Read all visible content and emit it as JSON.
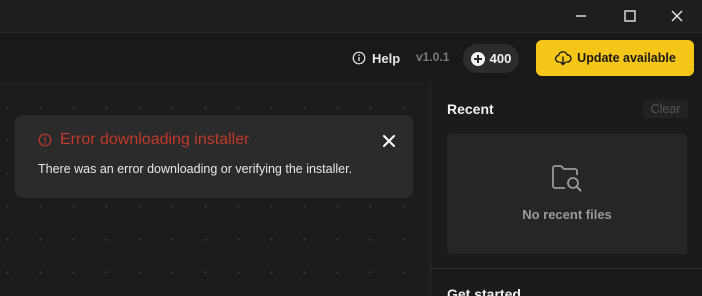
{
  "window_controls": {
    "minimize_icon": "minimize-icon",
    "maximize_icon": "maximize-icon",
    "close_icon": "close-icon"
  },
  "header": {
    "help_label": "Help",
    "version": "v1.0.1",
    "credits": "400",
    "update_label": "Update available"
  },
  "error": {
    "title": "Error downloading installer",
    "message": "There was an error downloading or verifying the installer."
  },
  "recent": {
    "title": "Recent",
    "clear_label": "Clear",
    "empty_text": "No recent files"
  },
  "get_started": {
    "title": "Get started"
  },
  "colors": {
    "accent": "#f5c518",
    "error": "#c0392b",
    "background": "#1e1e1e"
  }
}
